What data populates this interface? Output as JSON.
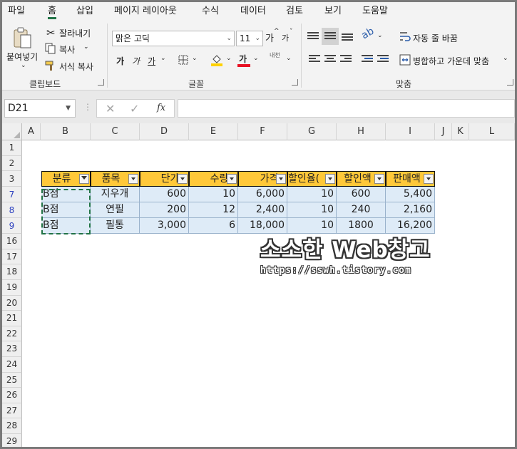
{
  "tabs": [
    "파일",
    "홈",
    "삽입",
    "페이지 레이아웃",
    "수식",
    "데이터",
    "검토",
    "보기",
    "도움말"
  ],
  "active_tab": "홈",
  "accent_color": "#217346",
  "clipboard": {
    "paste_label": "붙여넣기",
    "cut_label": "잘라내기",
    "copy_label": "복사",
    "format_painter_label": "서식 복사",
    "group_label": "클립보드"
  },
  "font": {
    "font_name": "맑은 고딕",
    "font_size": "11",
    "increase_label": "가",
    "decrease_label": "가",
    "bold_label": "가",
    "italic_label": "가",
    "underline_label": "가",
    "font_color_label": "가",
    "phonetic_label": "내천",
    "group_label": "글꼴"
  },
  "alignment": {
    "wrap_text_label": "자동 줄 바꿈",
    "merge_center_label": "병합하고 가운데 맞춤",
    "group_label": "맞춤"
  },
  "formula_bar": {
    "name_box": "D21",
    "fx_label": "fx",
    "formula": ""
  },
  "column_headers": [
    "A",
    "B",
    "C",
    "D",
    "E",
    "F",
    "G",
    "H",
    "I",
    "J",
    "K",
    "L"
  ],
  "row_headers": [
    "1",
    "2",
    "3",
    "7",
    "8",
    "9",
    "16",
    "17",
    "18",
    "19",
    "20",
    "21",
    "22",
    "23",
    "24",
    "25",
    "26",
    "27",
    "28",
    "29"
  ],
  "table": {
    "headers": [
      "분류",
      "품목",
      "단가",
      "수량",
      "가격",
      "할인율(",
      "할인액",
      "판매액"
    ],
    "rows": [
      [
        "B점",
        "지우개",
        "600",
        "10",
        "6,000",
        "10",
        "600",
        "5,400"
      ],
      [
        "B점",
        "연필",
        "200",
        "12",
        "2,400",
        "10",
        "240",
        "2,160"
      ],
      [
        "B점",
        "필통",
        "3,000",
        "6",
        "18,000",
        "10",
        "1800",
        "16,200"
      ]
    ]
  },
  "watermark": {
    "title": "소소한 Web창고",
    "url": "https://sswh.tistory.com"
  }
}
